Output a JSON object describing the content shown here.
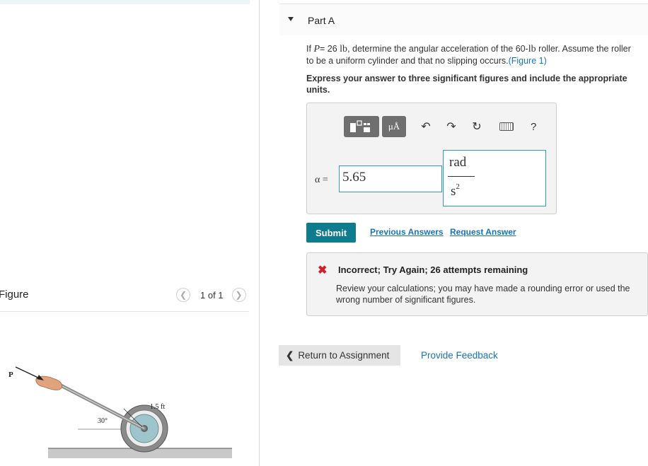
{
  "figure_panel": {
    "title": "Figure",
    "pager_text": "1 of 1",
    "diagram": {
      "force_label": "P",
      "length_label": "1.5 ft",
      "angle_label": "30°"
    }
  },
  "part": {
    "title": "Part A",
    "problem": {
      "lead": "If",
      "var_p": "P",
      "equals": "= 26",
      "unit_lb": "lb",
      "mid": ", determine the angular acceleration of the 60-",
      "unit_lb2": "lb",
      "rest": "roller. Assume the roller to be a uniform cylinder and that no slipping occurs.",
      "figure_link": "(Figure 1)"
    },
    "instructions": "Express your answer to three significant figures and include the appropriate units."
  },
  "answer": {
    "variable_label": "α =",
    "value": "5.65",
    "units_numerator": "rad",
    "units_denominator": "s",
    "units_exponent": "2"
  },
  "toolbar": {
    "templates_icon": "templates-icon",
    "units_label": "μÅ",
    "undo_icon": "undo-icon",
    "redo_icon": "redo-icon",
    "reset_icon": "reset-icon",
    "keyboard_icon": "keyboard-icon",
    "help_label": "?"
  },
  "actions": {
    "submit": "Submit",
    "previous_answers": "Previous Answers",
    "request_answer": "Request Answer"
  },
  "feedback": {
    "title": "Incorrect; Try Again; 26 attempts remaining",
    "message": "Review your calculations; you may have made a rounding error or used the wrong number of significant figures."
  },
  "footer": {
    "return_label": "Return to Assignment",
    "provide_feedback": "Provide Feedback"
  },
  "colors": {
    "accent": "#0e7c8f",
    "link": "#1a73b8",
    "error": "#d0202a",
    "input_border": "#2aa0b4"
  }
}
